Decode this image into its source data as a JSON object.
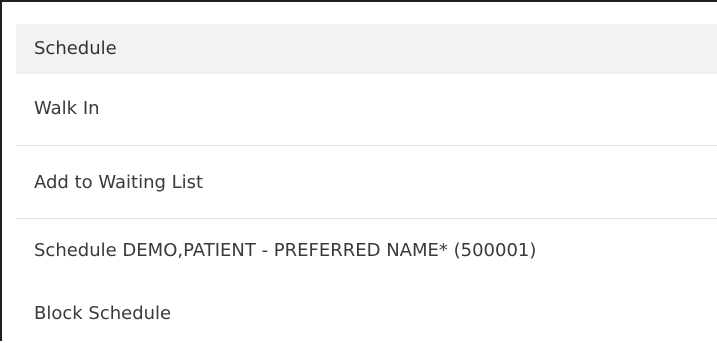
{
  "menu": {
    "header": "Schedule",
    "items": [
      "Walk In",
      "Add to Waiting List",
      "Schedule DEMO,PATIENT - PREFERRED NAME* (500001)",
      "Block Schedule"
    ]
  }
}
